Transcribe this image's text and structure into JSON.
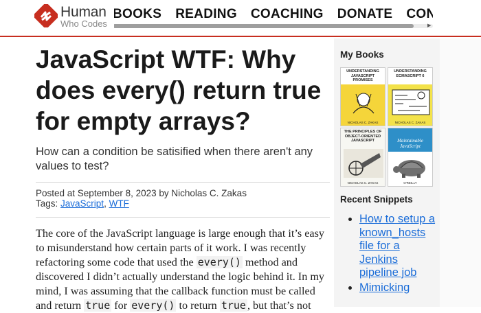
{
  "logo": {
    "title": "Human",
    "subtitle": "Who Codes"
  },
  "nav": {
    "items": [
      "BOOKS",
      "READING",
      "COACHING",
      "DONATE",
      "CONTACT"
    ]
  },
  "article": {
    "title": "JavaScript WTF: Why does every() return true for empty arrays?",
    "subtitle": "How can a condition be satisified when there aren't any values to test?",
    "posted_prefix": "Posted at ",
    "date": "September 8, 2023",
    "by": " by ",
    "author": "Nicholas C. Zakas",
    "tags_label": "Tags: ",
    "tags": [
      "JavaScript",
      "WTF"
    ],
    "tag_sep": ", ",
    "body": {
      "t1": "The core of the JavaScript language is large enough that it’s easy to misunderstand how certain parts of it work. I was recently refactoring some code that used the ",
      "c1": "every()",
      "t2": " method and discovered I didn’t actually understand the logic behind it. In my mind, I was assuming that the callback function must be called and return ",
      "c2": "true",
      "t3": " for ",
      "c3": "every()",
      "t4": " to return ",
      "c4": "true",
      "t5": ", but that’s not"
    }
  },
  "sidebar": {
    "books_heading": "My Books",
    "books": [
      {
        "title": "UNDERSTANDING JAVASCRIPT PROMISES",
        "author": "NICHOLAS C. ZAKAS",
        "color": "#f5d53a"
      },
      {
        "title": "UNDERSTANDING ECMASCRIPT 6",
        "author": "NICHOLAS C. ZAKAS",
        "color": "#f3e24a"
      },
      {
        "title": "THE PRINCIPLES OF OBJECT-ORIENTED JAVASCRIPT",
        "author": "NICHOLAS C. ZAKAS",
        "color": "#f7f7f2"
      },
      {
        "title": "Maintainable JavaScript",
        "author": "O'REILLY",
        "color": "#2e8fc8"
      }
    ],
    "snippets_heading": "Recent Snippets",
    "snippets": [
      "How to setup a known_hosts file for a Jenkins pipeline job",
      "Mimicking"
    ]
  },
  "colors": {
    "accent": "#c72e1f",
    "link": "#1a6cd8"
  }
}
